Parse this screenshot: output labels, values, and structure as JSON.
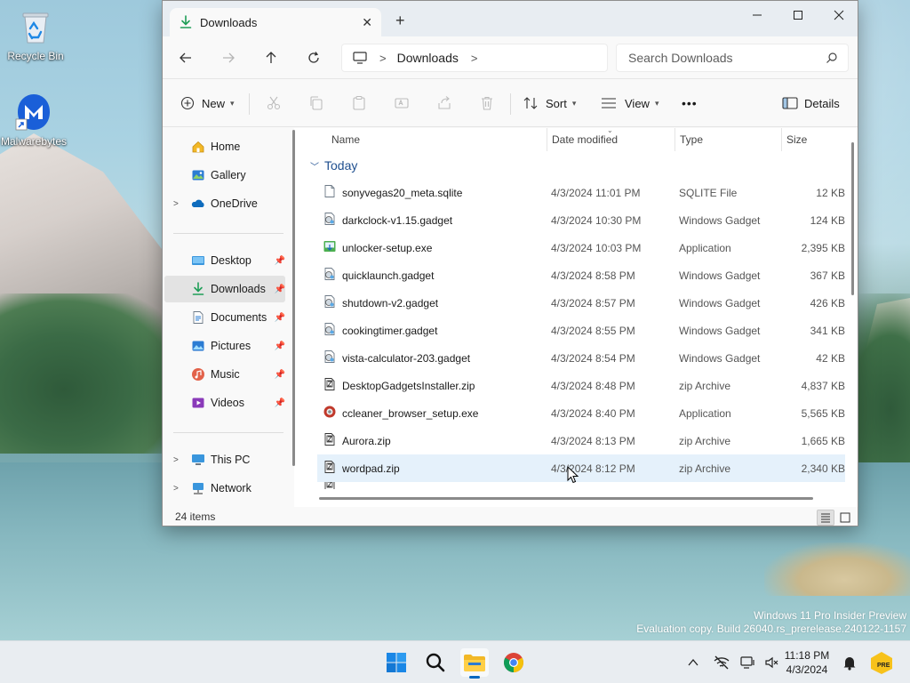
{
  "desktop": {
    "icons": [
      {
        "label": "Recycle Bin",
        "icon": "recycle-bin-icon"
      },
      {
        "label": "Malwarebytes",
        "icon": "malwarebytes-icon"
      }
    ],
    "watermark_line1": "Windows 11 Pro Insider Preview",
    "watermark_line2": "Evaluation copy. Build 26040.rs_prerelease.240122-1157"
  },
  "window": {
    "tab_title": "Downloads",
    "breadcrumb": "Downloads",
    "search_placeholder": "Search Downloads",
    "toolbar": {
      "new_label": "New",
      "sort_label": "Sort",
      "view_label": "View",
      "more_label": "•••",
      "details_label": "Details"
    },
    "sidebar": {
      "home": "Home",
      "gallery": "Gallery",
      "onedrive": "OneDrive",
      "desktop": "Desktop",
      "downloads": "Downloads",
      "documents": "Documents",
      "pictures": "Pictures",
      "music": "Music",
      "videos": "Videos",
      "thispc": "This PC",
      "network": "Network"
    },
    "columns": {
      "name": "Name",
      "date": "Date modified",
      "type": "Type",
      "size": "Size"
    },
    "group_label": "Today",
    "files": [
      {
        "name": "sonyvegas20_meta.sqlite",
        "date": "4/3/2024 11:01 PM",
        "type": "SQLITE File",
        "size": "12 KB",
        "icon": "file-icon"
      },
      {
        "name": "darkclock-v1.15.gadget",
        "date": "4/3/2024 10:30 PM",
        "type": "Windows Gadget",
        "size": "124 KB",
        "icon": "gadget-icon"
      },
      {
        "name": "unlocker-setup.exe",
        "date": "4/3/2024 10:03 PM",
        "type": "Application",
        "size": "2,395 KB",
        "icon": "installer-icon"
      },
      {
        "name": "quicklaunch.gadget",
        "date": "4/3/2024 8:58 PM",
        "type": "Windows Gadget",
        "size": "367 KB",
        "icon": "gadget-icon"
      },
      {
        "name": "shutdown-v2.gadget",
        "date": "4/3/2024 8:57 PM",
        "type": "Windows Gadget",
        "size": "426 KB",
        "icon": "gadget-icon"
      },
      {
        "name": "cookingtimer.gadget",
        "date": "4/3/2024 8:55 PM",
        "type": "Windows Gadget",
        "size": "341 KB",
        "icon": "gadget-icon"
      },
      {
        "name": "vista-calculator-203.gadget",
        "date": "4/3/2024 8:54 PM",
        "type": "Windows Gadget",
        "size": "42 KB",
        "icon": "gadget-icon"
      },
      {
        "name": "DesktopGadgetsInstaller.zip",
        "date": "4/3/2024 8:48 PM",
        "type": "zip Archive",
        "size": "4,837 KB",
        "icon": "zip-icon"
      },
      {
        "name": "ccleaner_browser_setup.exe",
        "date": "4/3/2024 8:40 PM",
        "type": "Application",
        "size": "5,565 KB",
        "icon": "ccleaner-icon"
      },
      {
        "name": "Aurora.zip",
        "date": "4/3/2024 8:13 PM",
        "type": "zip Archive",
        "size": "1,665 KB",
        "icon": "zip-icon"
      },
      {
        "name": "wordpad.zip",
        "date": "4/3/2024 8:12 PM",
        "type": "zip Archive",
        "size": "2,340 KB",
        "icon": "zip-icon"
      }
    ],
    "status_count": "24 items"
  },
  "taskbar": {
    "time": "11:18 PM",
    "date": "4/3/2024",
    "badge": "PRE"
  },
  "colors": {
    "accent": "#0067c0",
    "folder_yellow": "#f2b827",
    "hover_row": "#e5f1fb"
  }
}
